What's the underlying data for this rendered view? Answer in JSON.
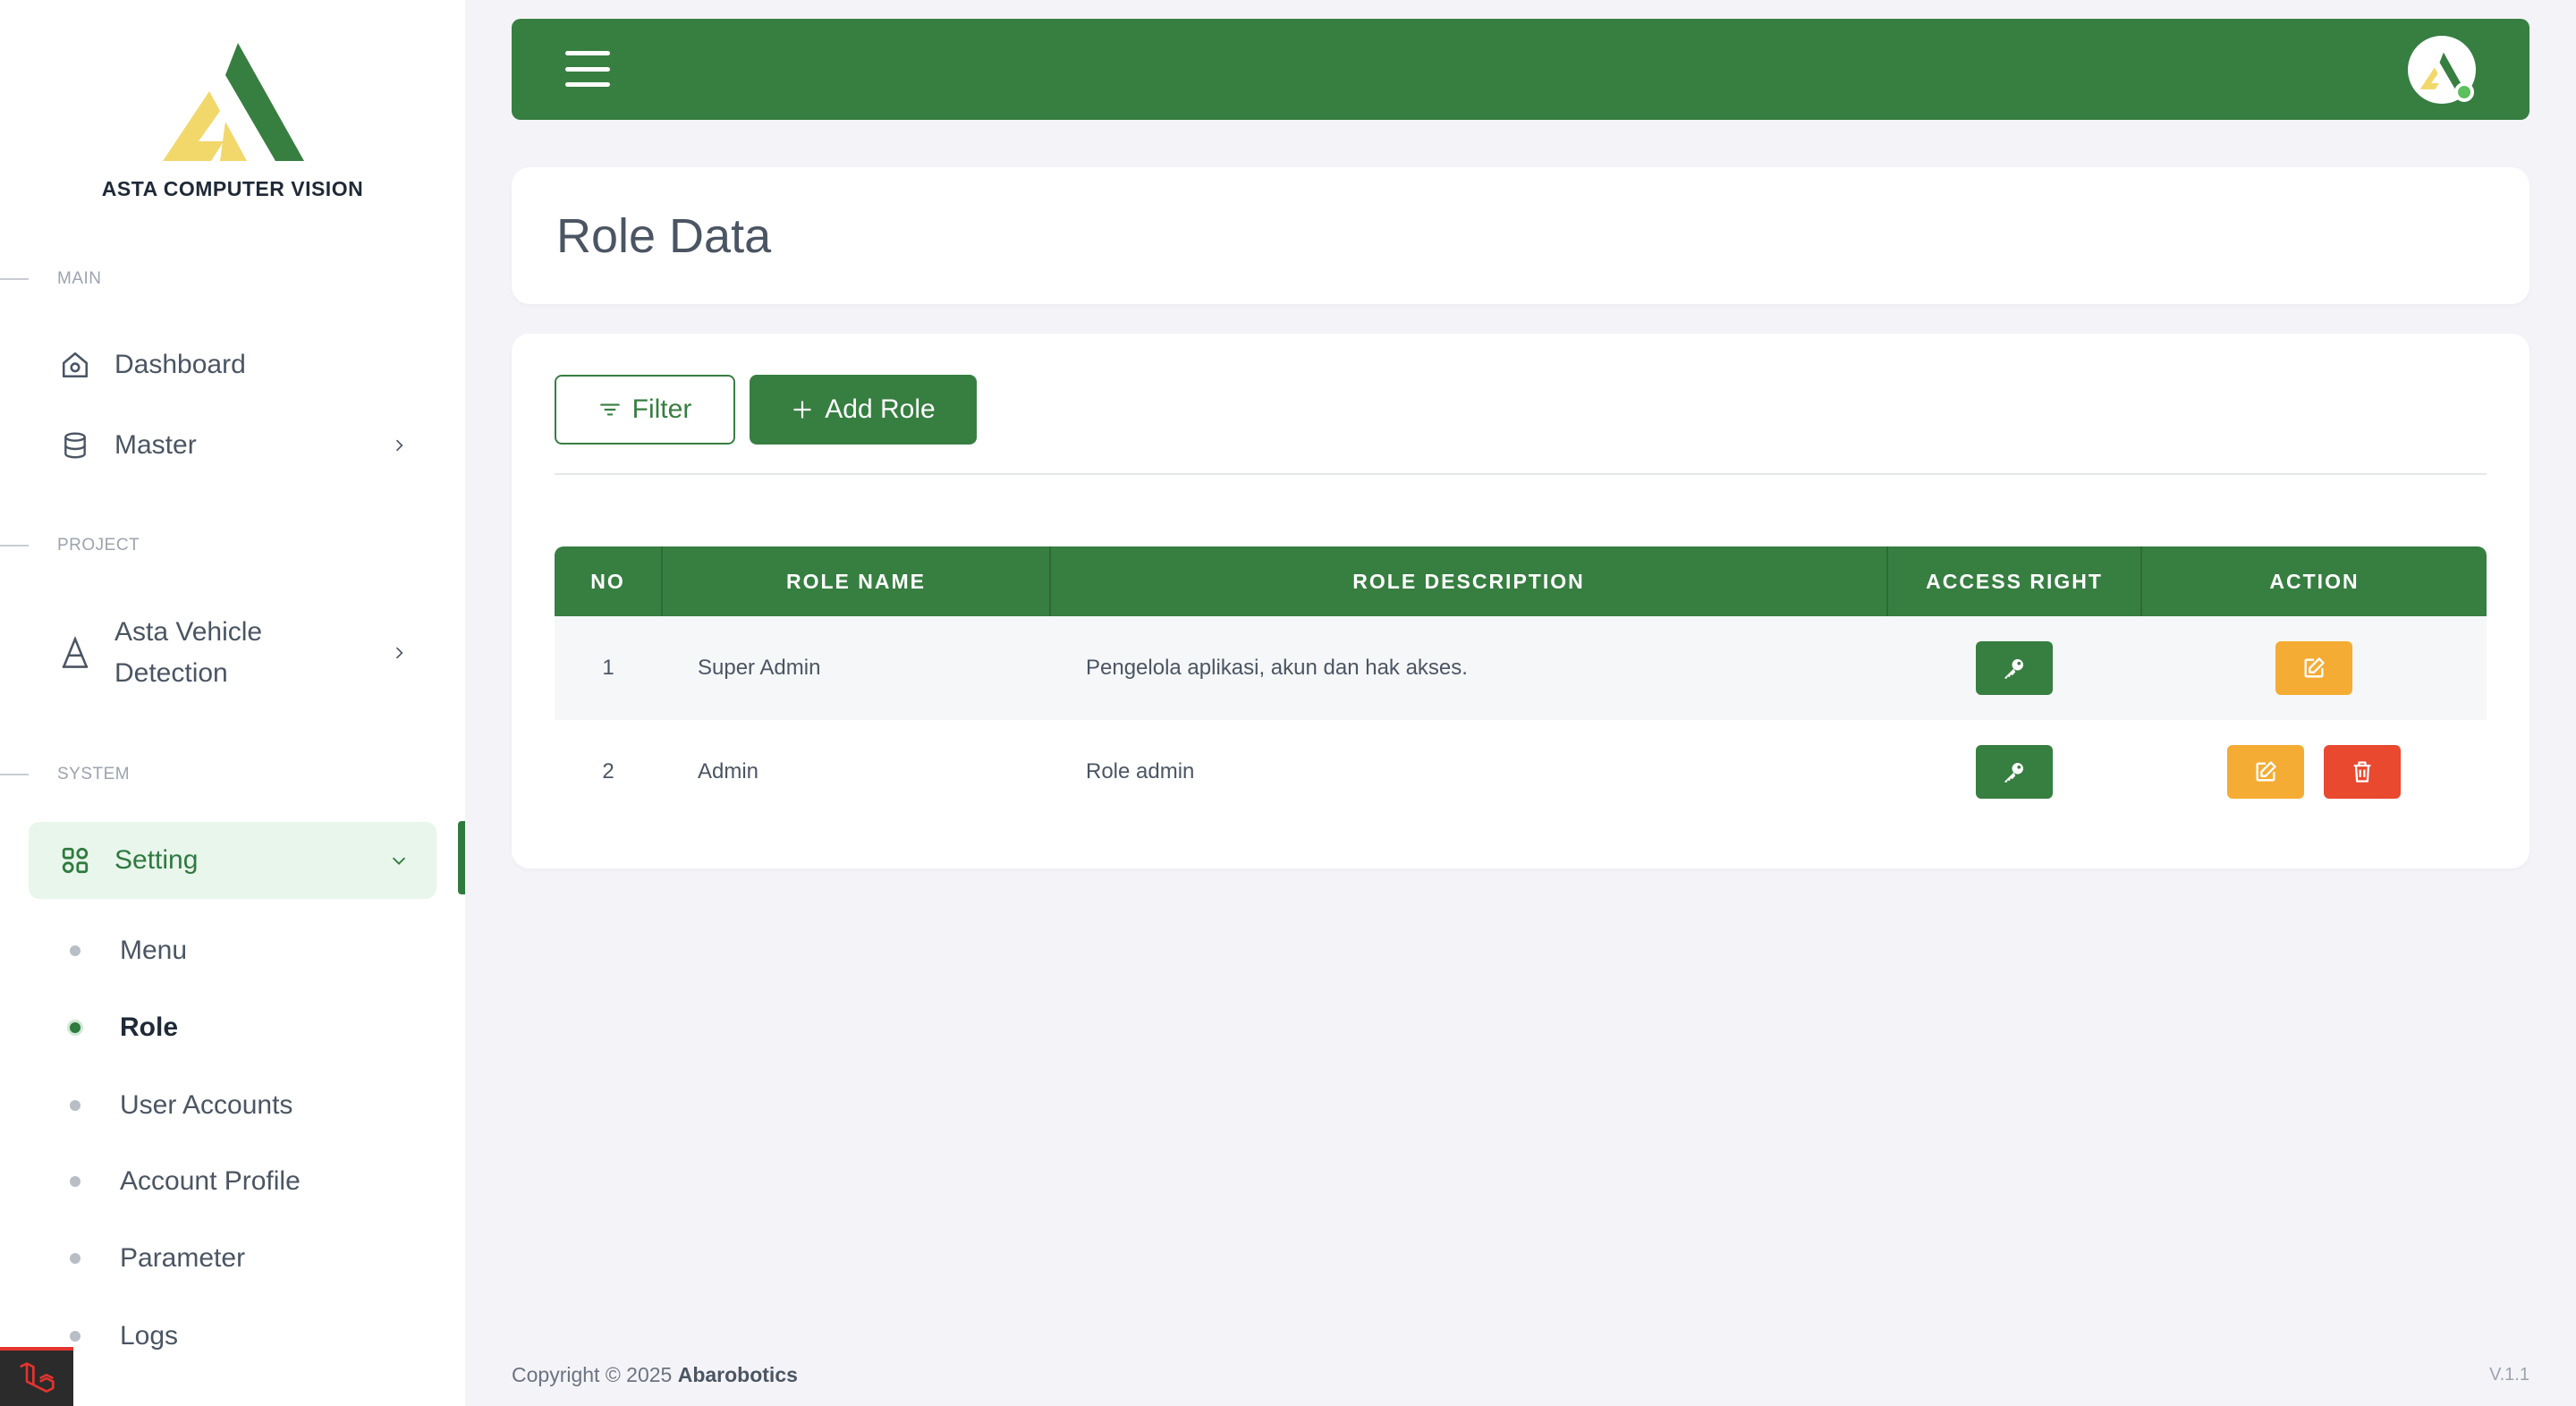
{
  "brand": {
    "name": "ASTA COMPUTER VISION",
    "colors": {
      "primary": "#377e41",
      "logo_yellow": "#f2d76b",
      "logo_green": "#377e41"
    }
  },
  "sidebar": {
    "sections": {
      "main": "MAIN",
      "project": "PROJECT",
      "system": "SYSTEM"
    },
    "items": {
      "dashboard": {
        "label": "Dashboard",
        "icon": "home-icon"
      },
      "master": {
        "label": "Master",
        "icon": "database-icon"
      },
      "asta_vehicle": {
        "label_line1": "Asta Vehicle",
        "label_line2": "Detection",
        "icon": "asta-a-icon"
      },
      "setting": {
        "label": "Setting",
        "icon": "grid-icon",
        "active": true
      }
    },
    "sub_items": [
      {
        "label": "Menu",
        "active": false
      },
      {
        "label": "Role",
        "active": true
      },
      {
        "label": "User Accounts",
        "active": false
      },
      {
        "label": "Account Profile",
        "active": false
      },
      {
        "label": "Parameter",
        "active": false
      },
      {
        "label": "Logs",
        "active": false
      }
    ]
  },
  "topbar": {
    "menu_icon": "hamburger-icon",
    "avatar_icon": "brand-logo-icon"
  },
  "page": {
    "title": "Role Data"
  },
  "toolbar": {
    "filter_label": "Filter",
    "add_label": "Add Role"
  },
  "table": {
    "headers": [
      "NO",
      "ROLE NAME",
      "ROLE DESCRIPTION",
      "ACCESS RIGHT",
      "ACTION"
    ],
    "rows": [
      {
        "no": "1",
        "name": "Super Admin",
        "description": "Pengelola aplikasi, akun dan hak akses.",
        "actions": [
          "edit"
        ]
      },
      {
        "no": "2",
        "name": "Admin",
        "description": "Role admin",
        "actions": [
          "edit",
          "delete"
        ]
      }
    ]
  },
  "footer": {
    "copyright": "Copyright © 2025",
    "company": "Abarobotics",
    "version": "V.1.1"
  }
}
